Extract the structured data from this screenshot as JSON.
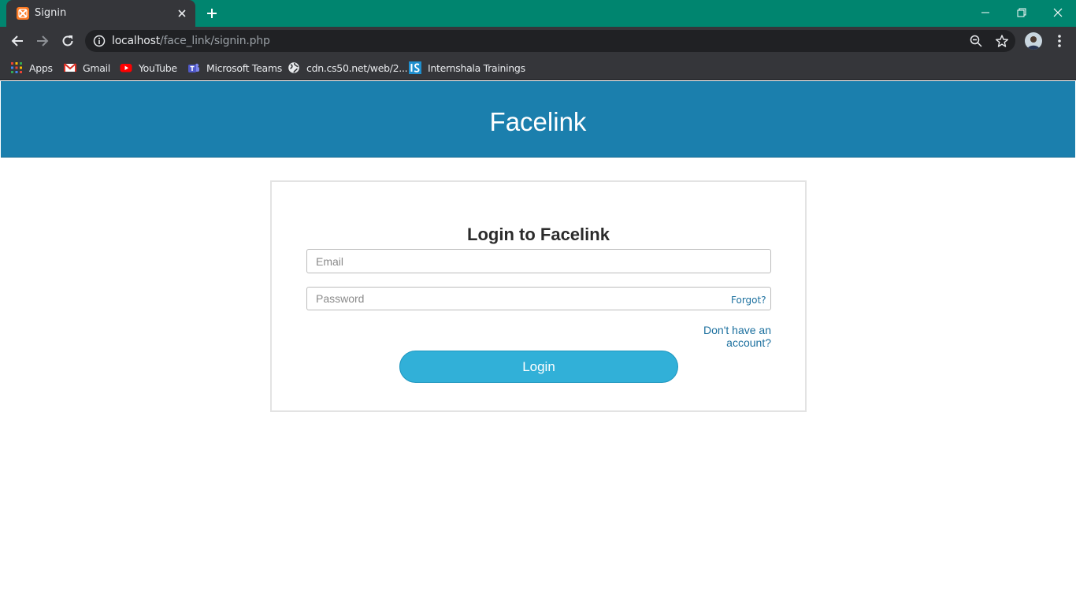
{
  "browser": {
    "tab": {
      "title": "Signin"
    },
    "address": {
      "host": "localhost",
      "path": "/face_link/signin.php"
    },
    "bookmarks": [
      {
        "label": "Apps",
        "icon": "apps-grid-icon"
      },
      {
        "label": "Gmail",
        "icon": "gmail-icon"
      },
      {
        "label": "YouTube",
        "icon": "youtube-icon"
      },
      {
        "label": "Microsoft Teams",
        "icon": "teams-icon"
      },
      {
        "label": "cdn.cs50.net/web/2...",
        "icon": "globe-icon"
      },
      {
        "label": "Internshala Trainings",
        "icon": "internshala-icon"
      }
    ],
    "colors": {
      "frame": "#00856f",
      "toolbar": "#35363a",
      "omnibox": "#202124"
    }
  },
  "page": {
    "header": {
      "brand": "Facelink",
      "color": "#1b7fad"
    },
    "login": {
      "title": "Login to Facelink",
      "email_placeholder": "Email",
      "password_placeholder": "Password",
      "forgot_label": "Forgot?",
      "signup_link": "Don't have an account?",
      "submit_label": "Login",
      "button_color": "#31b0d8"
    }
  }
}
